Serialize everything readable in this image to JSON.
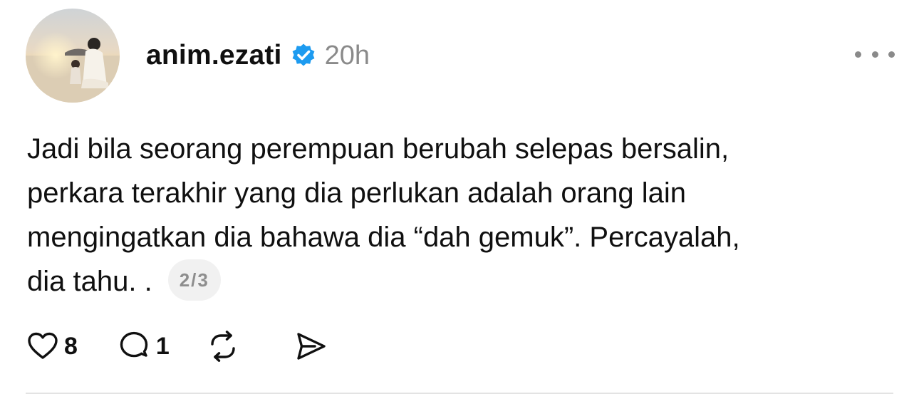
{
  "post": {
    "username": "anim.ezati",
    "verified_icon": "verified-badge-icon",
    "timestamp": "20h",
    "more_icon": "more-options-icon",
    "text_lines": [
      "Jadi bila seorang perempuan berubah selepas bersalin,",
      "perkara terakhir yang dia perlukan adalah orang lain",
      "mengingatkan dia bahawa dia “dah gemuk”. Percayalah,",
      "dia tahu. ."
    ],
    "pager": "2/3"
  },
  "actions": {
    "like": {
      "icon": "heart-icon",
      "count": "8"
    },
    "reply": {
      "icon": "comment-icon",
      "count": "1"
    },
    "repost": {
      "icon": "repost-icon"
    },
    "share": {
      "icon": "send-icon"
    }
  },
  "colors": {
    "text": "#101010",
    "muted": "#8a8a8a",
    "verified_blue": "#1d9bf0",
    "pager_bg": "#f1f1f1",
    "divider": "#e3e3e3"
  }
}
